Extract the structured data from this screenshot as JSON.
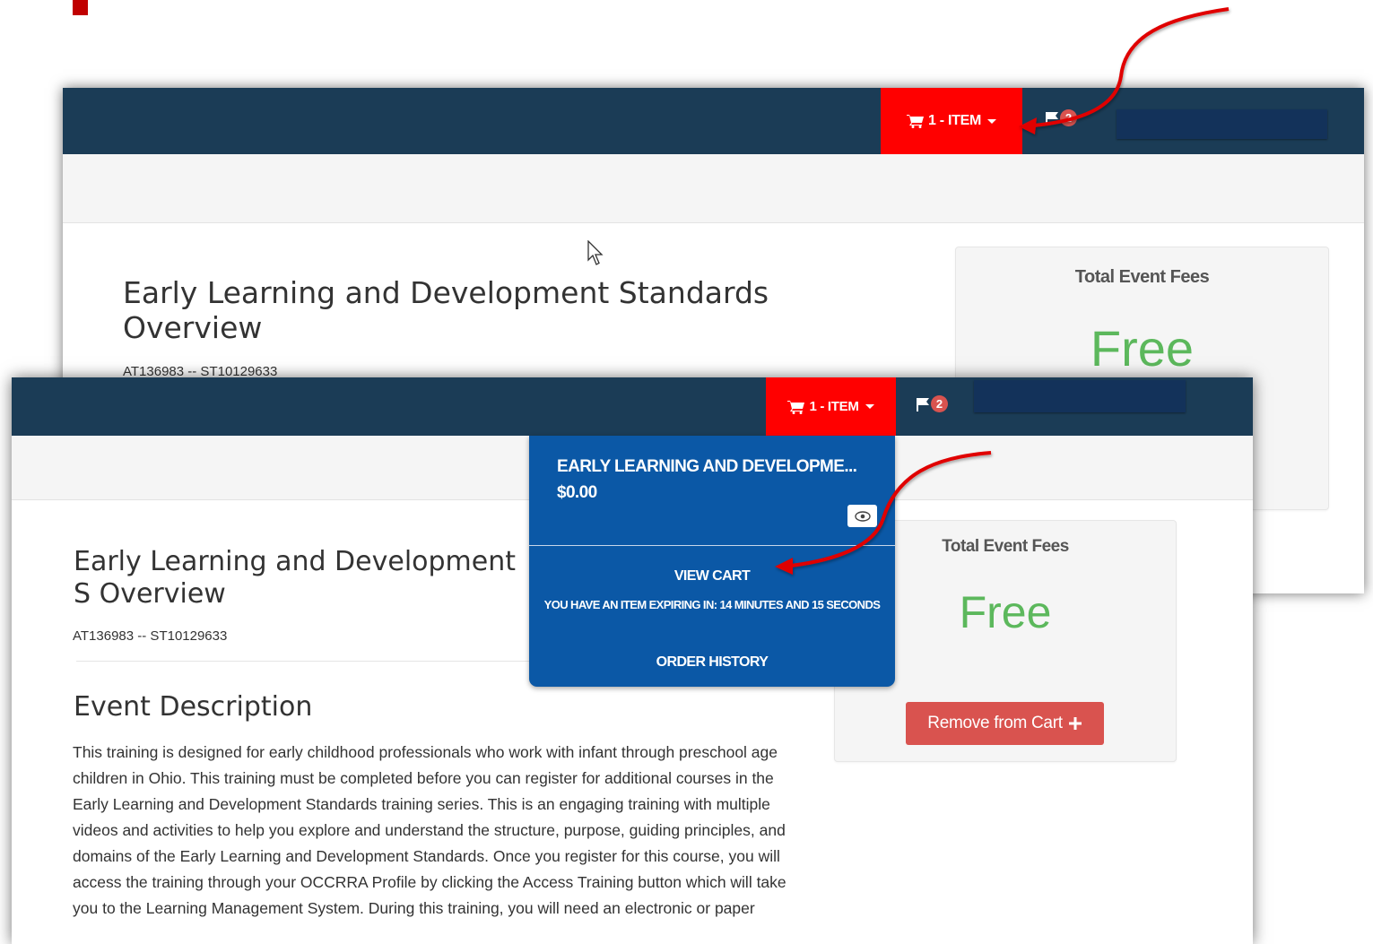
{
  "colors": {
    "navbar": "#1b3c56",
    "cart_button": "#ff0000",
    "dropdown": "#0b58a6",
    "fee_value": "#5cb85c",
    "remove_button": "#d9534f",
    "annotation_arrow": "#e00000"
  },
  "back": {
    "cart_label": "1 - ITEM",
    "notification_count": "2",
    "title": "Early Learning and Development Standards Overview",
    "code": "AT136983 -- ST10129633",
    "fee_label": "Total Event Fees",
    "fee_value": "Free"
  },
  "front": {
    "cart_label": "1 - ITEM",
    "notification_count": "2",
    "title": "Early Learning and Development S Overview",
    "code": "AT136983 -- ST10129633",
    "section_heading": "Event Description",
    "description": "This training is designed for early childhood professionals who work with infant through preschool age children in Ohio. This training must be completed before you can register for additional courses in the Early Learning and Development Standards training series. This is an engaging training with multiple videos and activities to help you explore and understand the structure, purpose, guiding principles, and domains of the Early Learning and Development Standards. Once you register for this course, you will access the training through your OCCRRA Profile by clicking the Access Training button which will take you to the Learning Management System. During this training, you will need an electronic or paper",
    "fee_label": "Total Event Fees",
    "fee_value": "Free",
    "remove_button": "Remove from Cart",
    "remove_icon": "plus-icon"
  },
  "cart_dropdown": {
    "item_title": "EARLY LEARNING AND DEVELOPME...",
    "item_price": "$0.00",
    "view_icon": "eye-icon",
    "view_cart": "VIEW CART",
    "expiring_notice": "YOU HAVE AN ITEM EXPIRING IN: 14 MINUTES AND 15 SECONDS",
    "order_history": "ORDER HISTORY"
  }
}
